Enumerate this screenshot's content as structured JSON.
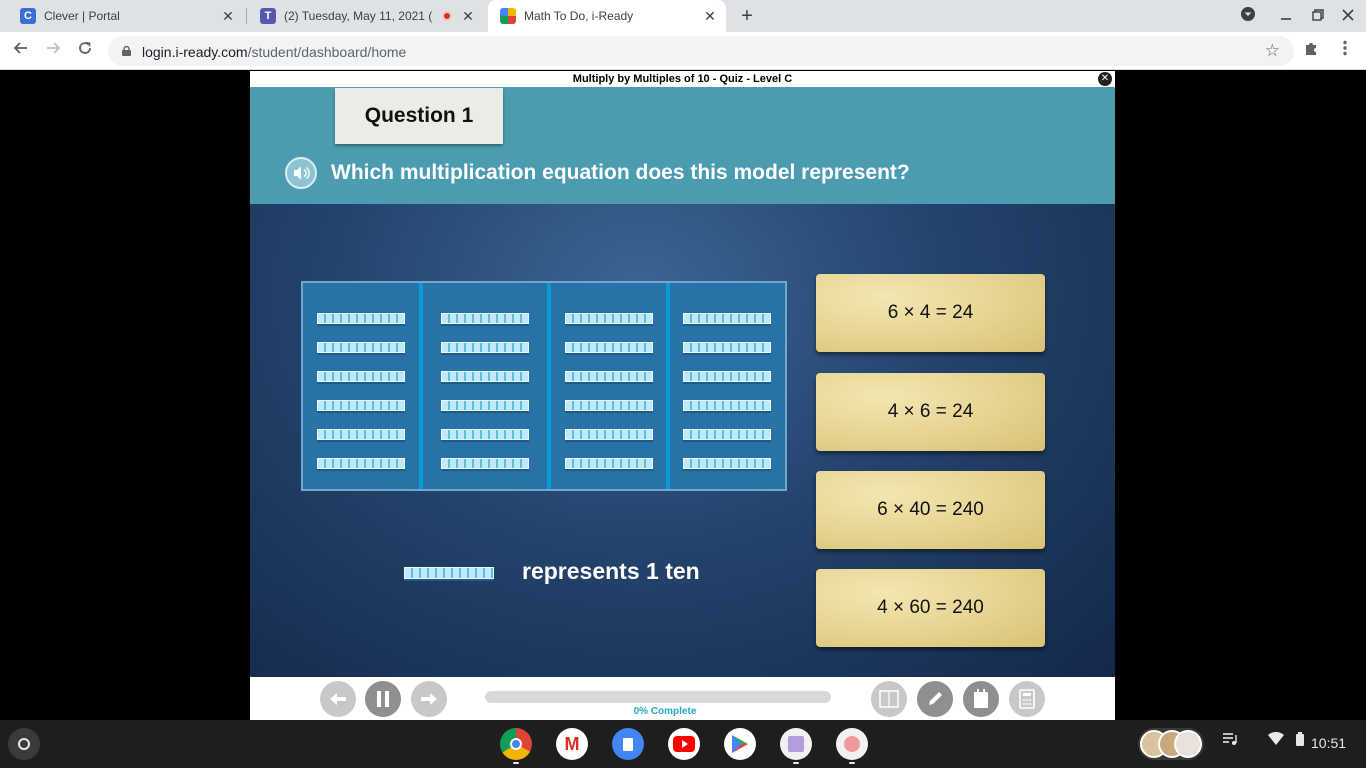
{
  "browser": {
    "tabs": [
      {
        "title": "Clever | Portal",
        "icon": "clever-icon",
        "active": false
      },
      {
        "title": "(2) Tuesday, May 11, 2021 (",
        "icon": "teams-icon",
        "active": false,
        "recording": true
      },
      {
        "title": "Math To Do, i-Ready",
        "icon": "iready-icon",
        "active": true
      }
    ],
    "close_glyph": "✕",
    "new_tab_glyph": "+",
    "url_host": "login.i-ready.com",
    "url_path": "/student/dashboard/home"
  },
  "activity": {
    "title": "Multiply by Multiples of 10 - Quiz - Level C",
    "close_glyph": "✕",
    "question_label": "Question 1",
    "question_text": "Which multiplication equation does this model represent?",
    "model": {
      "columns": 4,
      "rods_per_column": 6
    },
    "legend_text": "represents 1 ten",
    "answers": [
      "6 × 4 = 24",
      "4 × 6 = 24",
      "6 × 40 = 240",
      "4 × 60 = 240"
    ],
    "progress_percent": 0,
    "progress_label": "0% Complete"
  },
  "shelf": {
    "apps": [
      "chrome-icon",
      "gmail-icon",
      "docs-icon",
      "youtube-icon",
      "play-store-icon",
      "app-icon-1",
      "app-icon-2"
    ],
    "time": "10:51"
  },
  "colors": {
    "header_teal": "#4b9cb1",
    "answer_paper": "#e5d38f",
    "model_blue": "#2772a7",
    "progress_teal": "#24a7c4"
  }
}
